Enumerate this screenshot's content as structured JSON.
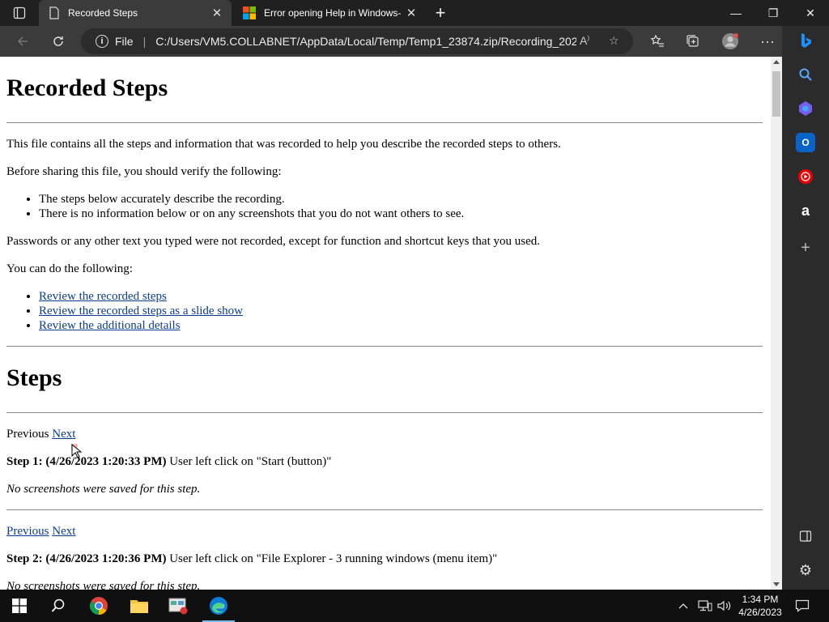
{
  "tabs": [
    {
      "label": "Recorded Steps",
      "active": true
    },
    {
      "label": "Error opening Help in Windows-",
      "active": false
    }
  ],
  "address": {
    "scheme_label": "File",
    "url": "C:/Users/VM5.COLLABNET/AppData/Local/Temp/Temp1_23874.zip/Recording_202..."
  },
  "page": {
    "title": "Recorded Steps",
    "intro": "This file contains all the steps and information that was recorded to help you describe the recorded steps to others.",
    "verify_heading": "Before sharing this file, you should verify the following:",
    "verify_items": [
      "The steps below accurately describe the recording.",
      "There is no information below or on any screenshots that you do not want others to see."
    ],
    "passwords_note": "Passwords or any other text you typed were not recorded, except for function and shortcut keys that you used.",
    "do_heading": "You can do the following:",
    "links": [
      "Review the recorded steps",
      "Review the recorded steps as a slide show",
      "Review the additional details"
    ],
    "steps_heading": "Steps",
    "steps": [
      {
        "nav_previous": "Previous",
        "nav_next": "Next",
        "label": "Step 1: (4/26/2023 1:20:33 PM)",
        "text": " User left click on \"Start (button)\"",
        "note": "No screenshots were saved for this step."
      },
      {
        "nav_previous": "Previous",
        "nav_next": "Next",
        "label": "Step 2: (4/26/2023 1:20:36 PM)",
        "text": " User left click on \"File Explorer - 3 running windows (menu item)\"",
        "note": "No screenshots were saved for this step."
      }
    ]
  },
  "taskbar": {
    "time": "1:34 PM",
    "date": "4/26/2023"
  },
  "colors": {
    "link": "#0b3d91",
    "chrome_dark": "#202020",
    "toolbar": "#3b3b3b",
    "taskbar": "#101010"
  }
}
